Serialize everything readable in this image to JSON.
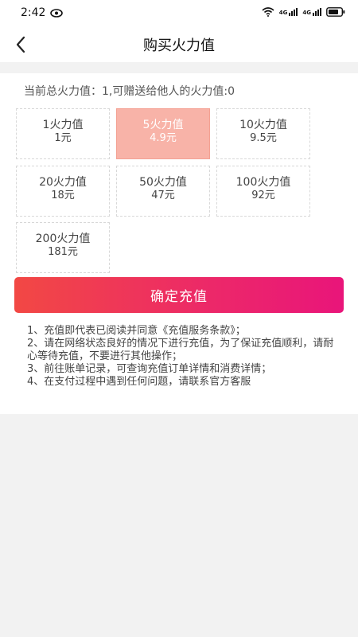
{
  "status": {
    "time": "2:42",
    "signal1": "4G",
    "signal2": "4G"
  },
  "header": {
    "title": "购买火力值"
  },
  "summary": "当前总火力值：1,可赠送给他人的火力值:0",
  "options": [
    {
      "amount": "1火力值",
      "price": "1元",
      "selected": false
    },
    {
      "amount": "5火力值",
      "price": "4.9元",
      "selected": true
    },
    {
      "amount": "10火力值",
      "price": "9.5元",
      "selected": false
    },
    {
      "amount": "20火力值",
      "price": "18元",
      "selected": false
    },
    {
      "amount": "50火力值",
      "price": "47元",
      "selected": false
    },
    {
      "amount": "100火力值",
      "price": "92元",
      "selected": false
    },
    {
      "amount": "200火力值",
      "price": "181元",
      "selected": false
    }
  ],
  "confirm_label": "确定充值",
  "notes": [
    "1、充值即代表已阅读并同意《充值服务条款》；",
    "2、请在网络状态良好的情况下进行充值，为了保证充值顺利，请耐心等待充值，不要进行其他操作；",
    "3、前往账单记录，可查询充值订单详情和消费详情；",
    "4、在支付过程中遇到任何问题，请联系官方客服"
  ],
  "colors": {
    "accent_start": "#f24844",
    "accent_end": "#e9157a",
    "selected_bg": "#f8b3a8"
  }
}
